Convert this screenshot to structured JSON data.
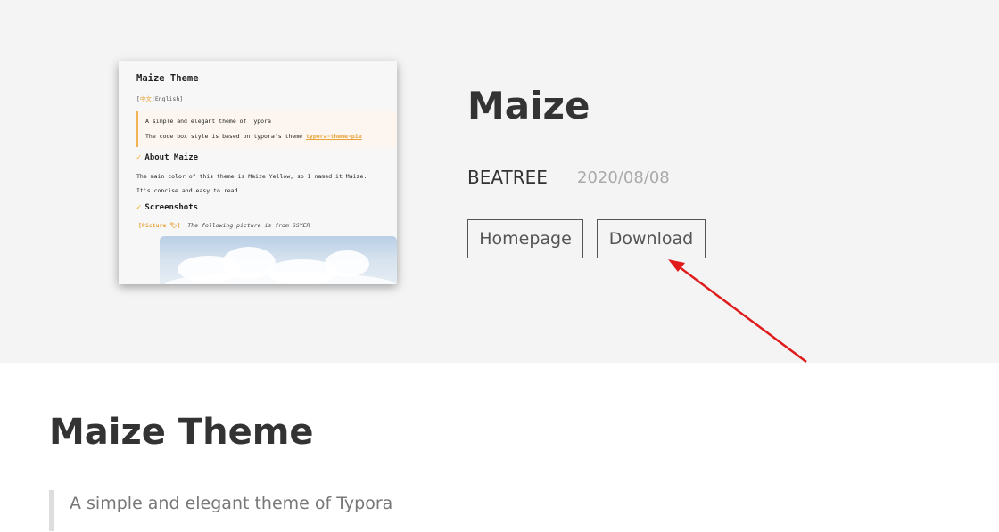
{
  "preview": {
    "title": "Maize Theme",
    "lang": {
      "open": "[",
      "zh": "中文",
      "sep": "|",
      "en": "English",
      "close": "]"
    },
    "quote_line1": "A simple and elegant theme of Typora",
    "quote_line2_prefix": "The code box style is based on typora's theme ",
    "quote_link": "typora-theme-pie",
    "h_about": "About Maize",
    "about_p1": "The main color of this theme is Maize Yellow, so I named it Maize.",
    "about_p2": "It's concise and easy to read.",
    "h_screenshots": "Screenshots",
    "picture_tag": "[Picture 🏷]",
    "picture_caption": "The following picture is from SSYER",
    "check_icon": "✓",
    "accent": "#f0b32c"
  },
  "theme": {
    "name": "Maize",
    "author": "BEATREE",
    "date": "2020/08/08",
    "homepage_label": "Homepage",
    "download_label": "Download"
  },
  "annotation": {
    "arrow_color": "#e01b1b"
  },
  "content": {
    "title": "Maize Theme",
    "quote": "A simple and elegant theme of Typora"
  }
}
